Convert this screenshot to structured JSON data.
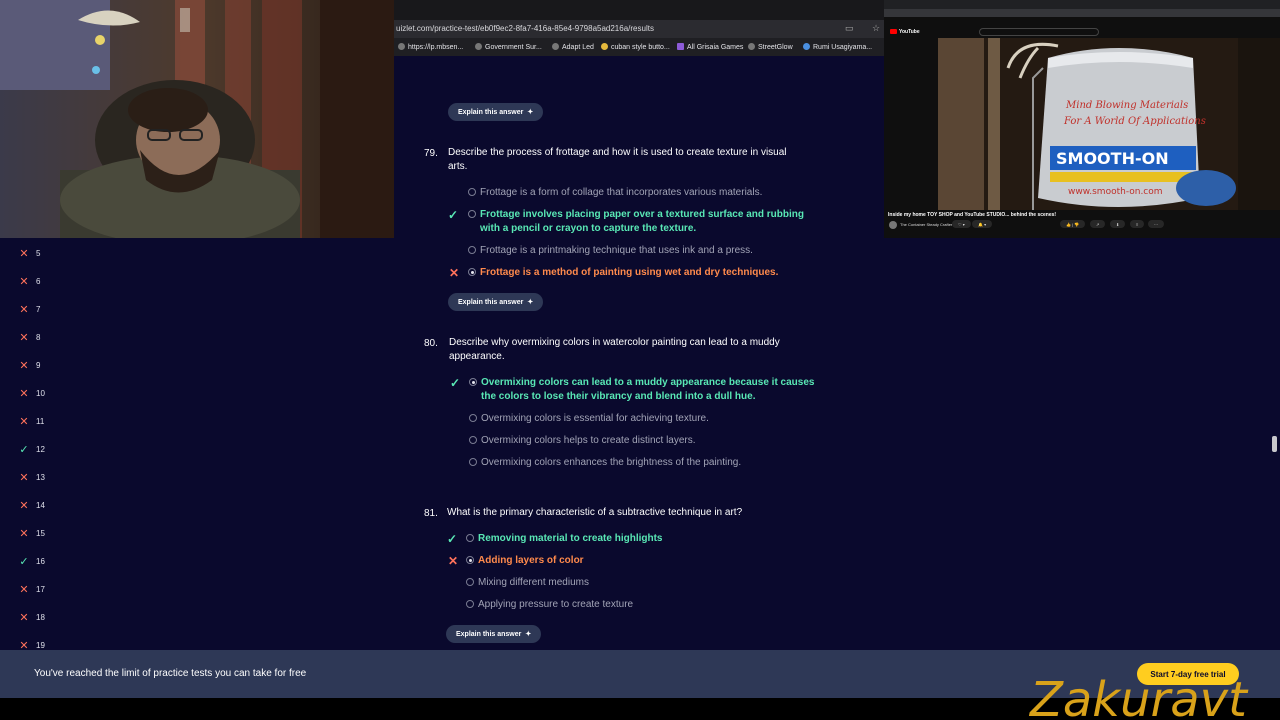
{
  "browser": {
    "url_prefix": "",
    "url": "uizlet.com/practice-test/eb0f9ec2-8fa7-416a-85e4-9798a5ad216a/results",
    "bookmarks": [
      "https://lp.mbsen...",
      "Government Sur...",
      "Adapt Led",
      "cuban style butto...",
      "All Grisaia Games",
      "StreetGlow",
      "Rumi Usagiyama..."
    ]
  },
  "sidebar": {
    "items": [
      {
        "num": "5",
        "status": "wrong"
      },
      {
        "num": "6",
        "status": "wrong"
      },
      {
        "num": "7",
        "status": "wrong"
      },
      {
        "num": "8",
        "status": "wrong"
      },
      {
        "num": "9",
        "status": "wrong"
      },
      {
        "num": "10",
        "status": "wrong"
      },
      {
        "num": "11",
        "status": "wrong"
      },
      {
        "num": "12",
        "status": "correct"
      },
      {
        "num": "13",
        "status": "wrong"
      },
      {
        "num": "14",
        "status": "wrong"
      },
      {
        "num": "15",
        "status": "wrong"
      },
      {
        "num": "16",
        "status": "correct"
      },
      {
        "num": "17",
        "status": "wrong"
      },
      {
        "num": "18",
        "status": "wrong"
      },
      {
        "num": "19",
        "status": "wrong"
      }
    ]
  },
  "explain_label": "Explain this answer",
  "questions": [
    {
      "num": "79.",
      "text_line1": "Describe the process of frottage and how it is used to create texture in visual",
      "text_line2": "arts.",
      "options": [
        {
          "line1": "Frottage is a form of collage that incorporates various materials.",
          "line2": ""
        },
        {
          "line1": "Frottage involves placing paper over a textured surface and rubbing",
          "line2": "with a pencil or crayon to capture the texture."
        },
        {
          "line1": "Frottage is a printmaking technique that uses ink and a press.",
          "line2": ""
        },
        {
          "line1": "Frottage is a method of painting using wet and dry techniques.",
          "line2": ""
        }
      ]
    },
    {
      "num": "80.",
      "text_line1": "Describe why overmixing colors in watercolor painting can lead to a muddy",
      "text_line2": "appearance.",
      "options": [
        {
          "line1": "Overmixing colors can lead to a muddy appearance because it causes",
          "line2": "the colors to lose their vibrancy and blend into a dull hue."
        },
        {
          "line1": "Overmixing colors is essential for achieving texture.",
          "line2": ""
        },
        {
          "line1": "Overmixing colors helps to create distinct layers.",
          "line2": ""
        },
        {
          "line1": "Overmixing colors enhances the brightness of the painting.",
          "line2": ""
        }
      ]
    },
    {
      "num": "81.",
      "text_line1": "What is the primary characteristic of a subtractive technique in art?",
      "options": [
        {
          "line1": "Removing material to create highlights"
        },
        {
          "line1": "Adding layers of color"
        },
        {
          "line1": "Mixing different mediums"
        },
        {
          "line1": "Applying pressure to create texture"
        }
      ]
    }
  ],
  "banner": {
    "text": "You've reached the limit of practice tests you can take for free",
    "cta": "Start 7-day free trial"
  },
  "watermark": "Zakuravt",
  "youtube": {
    "logo": "YouTube",
    "video_title": "Inside my home TOY SHOP and YouTube STUDIO... behind the scenes!",
    "channel": "The Container Steady Crafter",
    "pot_text1": "SMOOTH-ON",
    "pot_text2": "www.smooth-on.com",
    "pot_text3": "Mind Blowing Materials",
    "pot_text4": "For A World Of Applications"
  },
  "colors": {
    "background": "#0a092d",
    "correct": "#59e8b5",
    "wrong": "#ff8a4c",
    "banner": "#2e3856",
    "cta": "#ffcd1f"
  }
}
